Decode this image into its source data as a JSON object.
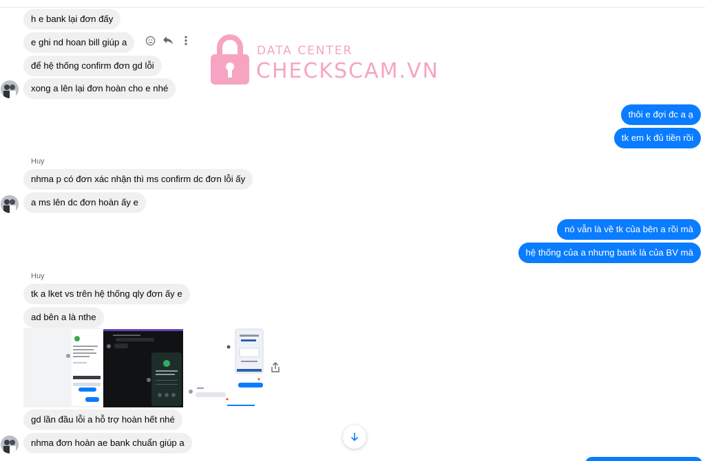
{
  "watermark": {
    "top_line": "DATA CENTER",
    "main_line": "CHECKSCAM.VN"
  },
  "conversation": {
    "group1": [
      "h e bank lại đơn đấy",
      "e ghi nd hoan bill giúp a",
      "để hệ thống confirm đơn gd lỗi",
      "xong a lên lại đơn hoàn cho e nhé"
    ],
    "out1": [
      "thôi e đợi đc a ạ",
      "tk em k đủ tiền rồi"
    ],
    "sender_a": "Huy",
    "group2": [
      "nhma p có đơn xác nhận thì ms confirm dc đơn lỗi ấy",
      "a ms lên dc đơn hoàn ấy e"
    ],
    "out2": [
      "nó vẫn là về tk của bên a rồi mà",
      "hệ thống của a nhưng bank là của BV mà"
    ],
    "sender_b": "Huy",
    "group3": [
      "tk a lket vs trên hệ thống qly đơn ấy e",
      "ad bên a là nthe"
    ],
    "group4": [
      "gd lần đầu lỗi a hỗ trợ hoàn hết nhé",
      "nhma đơn hoàn ae bank chuẩn giúp a"
    ]
  },
  "icons": {
    "react": "smile-icon",
    "reply": "reply-icon",
    "more": "more-vertical-icon",
    "share": "share-icon",
    "scroll_down": "arrow-down-icon"
  },
  "colors": {
    "outgoing_bubble": "#0a7cff",
    "incoming_bubble": "#f0f0f0",
    "watermark": "#f6a4c2"
  }
}
